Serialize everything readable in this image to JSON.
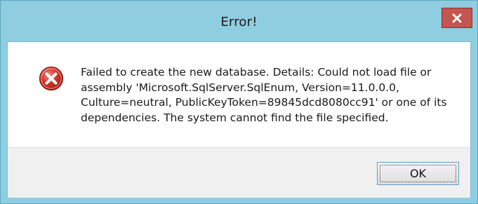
{
  "window": {
    "title": "Error!",
    "close_glyph": "x"
  },
  "dialog": {
    "icon": "error-icon",
    "message": "Failed to create the new database. Details: Could not load file or\nassembly 'Microsoft.SqlServer.SqlEnum, Version=11.0.0.0,\nCulture=neutral, PublicKeyToken=89845dcd8080cc91' or one of its\ndependencies. The system cannot find the file specified.",
    "ok_label": "OK"
  },
  "colors": {
    "frame": "#8fcde0",
    "close_button": "#c5554f",
    "error_icon": "#d1342a"
  }
}
